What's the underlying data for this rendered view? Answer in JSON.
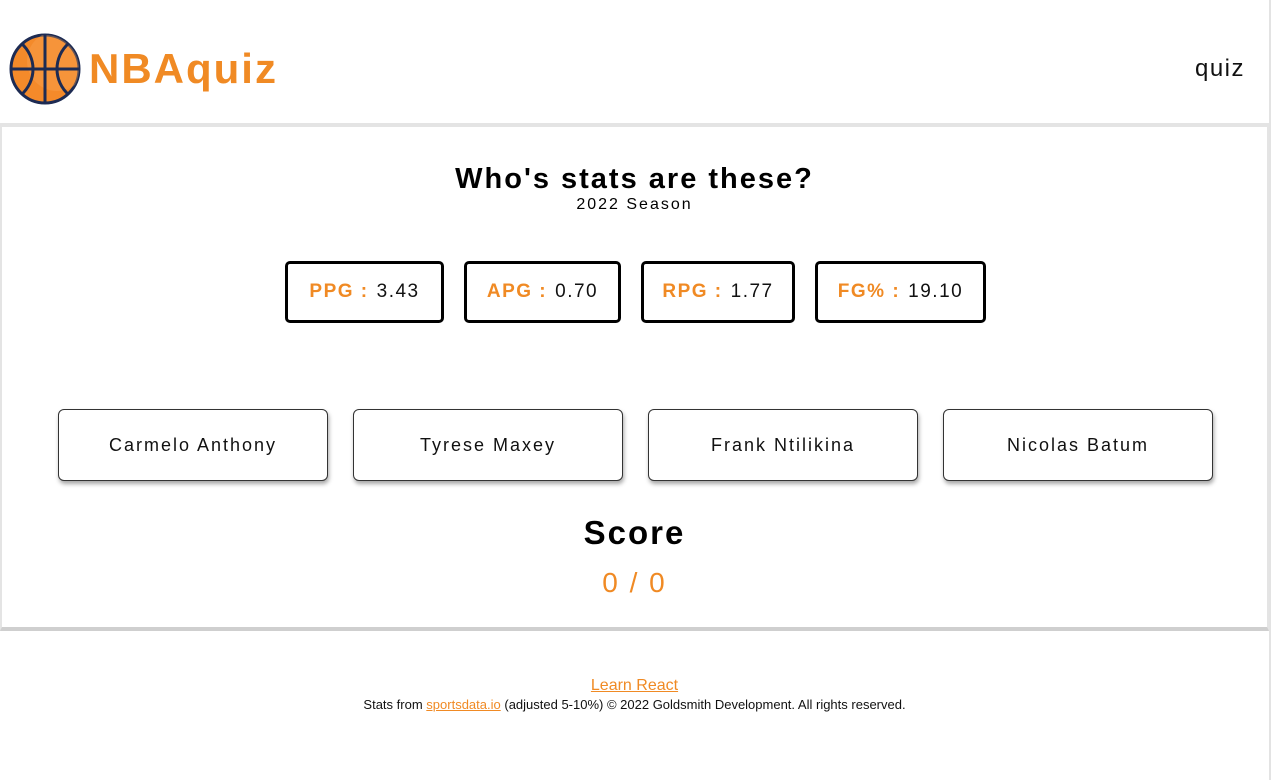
{
  "header": {
    "brand": "NBAquiz",
    "nav_link": "quiz"
  },
  "quiz": {
    "question": "Who's stats are these?",
    "season": "2022 Season",
    "stats": [
      {
        "label": "PPG :",
        "value": "3.43"
      },
      {
        "label": "APG :",
        "value": "0.70"
      },
      {
        "label": "RPG :",
        "value": "1.77"
      },
      {
        "label": "FG% :",
        "value": "19.10"
      }
    ],
    "answers": [
      "Carmelo Anthony",
      "Tyrese Maxey",
      "Frank Ntilikina",
      "Nicolas Batum"
    ],
    "score_title": "Score",
    "score_value": "0 / 0"
  },
  "footer": {
    "learn_link": "Learn React",
    "credits_prefix": "Stats from",
    "credits_link": "sportsdata.io",
    "credits_suffix": "(adjusted 5-10%) © 2022 Goldsmith Development. All rights reserved."
  },
  "colors": {
    "accent": "#f08a24",
    "ball_outline": "#1d2b53"
  },
  "icons": {
    "logo": "basketball-icon"
  }
}
